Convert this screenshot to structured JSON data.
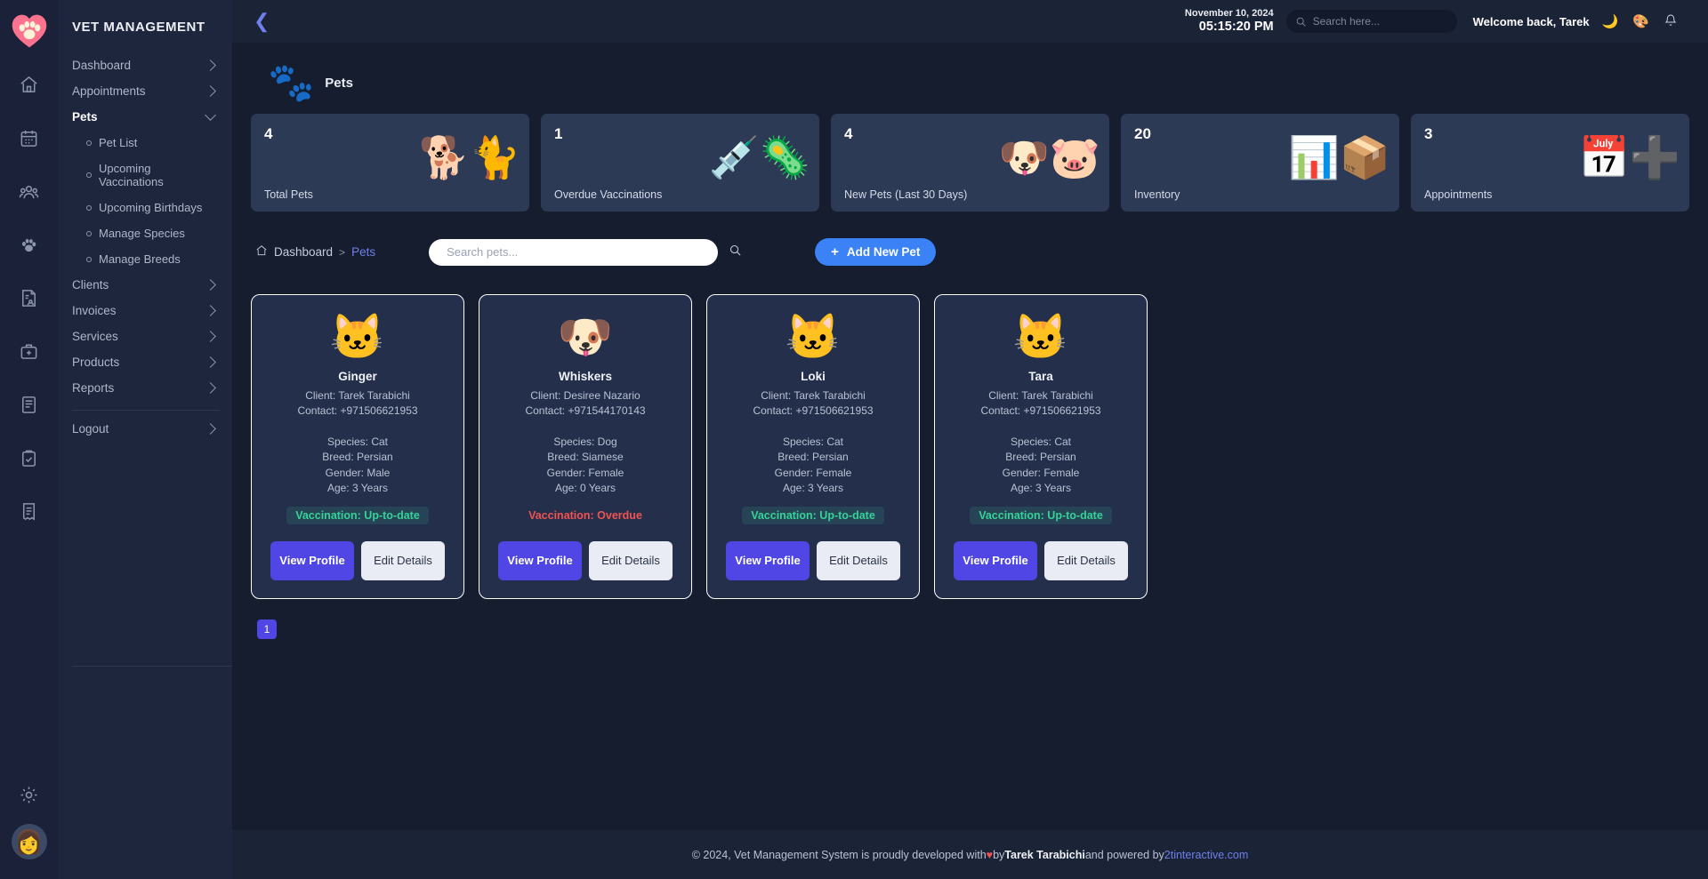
{
  "brand": {
    "logo_icon": "paw-heart-logo",
    "title": "VET MANAGEMENT"
  },
  "rail": {
    "items": [
      {
        "name": "home-icon"
      },
      {
        "name": "calendar-icon"
      },
      {
        "name": "clients-icon"
      },
      {
        "name": "paw-icon"
      },
      {
        "name": "records-icon"
      },
      {
        "name": "medkit-icon"
      },
      {
        "name": "document-icon"
      },
      {
        "name": "clipboard-check-icon"
      },
      {
        "name": "invoice-icon"
      }
    ],
    "settings_icon": "gear-icon",
    "avatar_icon": "user-avatar"
  },
  "sidebar": {
    "items": [
      {
        "label": "Dashboard",
        "expanded": false,
        "active": false
      },
      {
        "label": "Appointments",
        "expanded": false,
        "active": false
      },
      {
        "label": "Pets",
        "expanded": true,
        "active": true
      },
      {
        "label": "Clients",
        "expanded": false,
        "active": false
      },
      {
        "label": "Invoices",
        "expanded": false,
        "active": false
      },
      {
        "label": "Services",
        "expanded": false,
        "active": false
      },
      {
        "label": "Products",
        "expanded": false,
        "active": false
      },
      {
        "label": "Reports",
        "expanded": false,
        "active": false
      }
    ],
    "pets_submenu": [
      {
        "label": "Pet List"
      },
      {
        "label": "Upcoming Vaccinations"
      },
      {
        "label": "Upcoming Birthdays"
      },
      {
        "label": "Manage Species"
      },
      {
        "label": "Manage Breeds"
      }
    ],
    "logout": {
      "label": "Logout"
    }
  },
  "topbar": {
    "back_icon": "chevron-left-icon",
    "date": "November 10, 2024",
    "time": "05:15:20 PM",
    "search": {
      "placeholder": "Search here...",
      "value": "",
      "icon": "search-icon"
    },
    "welcome": "Welcome back, Tarek",
    "theme_toggle_icon": "moon-icon",
    "palette_icon": "palette-icon",
    "notifications_icon": "bell-icon"
  },
  "page": {
    "icon": "pets-box-icon",
    "title": "Pets"
  },
  "stats": [
    {
      "value": "4",
      "label": "Total Pets",
      "icon": "dog-cat-icon"
    },
    {
      "value": "1",
      "label": "Overdue Vaccinations",
      "icon": "syringe-virus-icon"
    },
    {
      "value": "4",
      "label": "New Pets (Last 30 Days)",
      "icon": "two-pets-icon"
    },
    {
      "value": "20",
      "label": "Inventory",
      "icon": "inventory-chart-icon"
    },
    {
      "value": "3",
      "label": "Appointments",
      "icon": "calendar-plus-icon"
    }
  ],
  "breadcrumb": {
    "home_icon": "home-icon",
    "root": "Dashboard",
    "separator": ">",
    "current": "Pets"
  },
  "pet_search": {
    "placeholder": "Search pets...",
    "value": "",
    "button_icon": "search-icon"
  },
  "add_pet_button": {
    "plus": "+",
    "label": "Add New Pet"
  },
  "labels": {
    "client_prefix": "Client: ",
    "contact_prefix": "Contact: ",
    "species_prefix": "Species: ",
    "breed_prefix": "Breed: ",
    "gender_prefix": "Gender: ",
    "age_prefix": "Age: ",
    "view_profile": "View Profile",
    "edit_details": "Edit Details"
  },
  "pets": [
    {
      "avatar_icon": "cat-face-icon",
      "name": "Ginger",
      "client": "Client: Tarek Tarabichi",
      "contact": "Contact: +971506621953",
      "species": "Species: Cat",
      "breed": "Breed: Persian",
      "gender": "Gender: Male",
      "age": "Age: 3 Years",
      "vaccination": "Vaccination: Up-to-date",
      "vaccination_status": "ok",
      "view_label": "View Profile",
      "edit_label": "Edit Details"
    },
    {
      "avatar_icon": "dog-face-icon",
      "name": "Whiskers",
      "client": "Client: Desiree Nazario",
      "contact": "Contact: +971544170143",
      "species": "Species: Dog",
      "breed": "Breed: Siamese",
      "gender": "Gender: Female",
      "age": "Age: 0 Years",
      "vaccination": "Vaccination: Overdue",
      "vaccination_status": "overdue",
      "view_label": "View Profile",
      "edit_label": "Edit Details"
    },
    {
      "avatar_icon": "cat-face-icon",
      "name": "Loki",
      "client": "Client: Tarek Tarabichi",
      "contact": "Contact: +971506621953",
      "species": "Species: Cat",
      "breed": "Breed: Persian",
      "gender": "Gender: Female",
      "age": "Age: 3 Years",
      "vaccination": "Vaccination: Up-to-date",
      "vaccination_status": "ok",
      "view_label": "View Profile",
      "edit_label": "Edit Details"
    },
    {
      "avatar_icon": "cat-face-icon",
      "name": "Tara",
      "client": "Client: Tarek Tarabichi",
      "contact": "Contact: +971506621953",
      "species": "Species: Cat",
      "breed": "Breed: Persian",
      "gender": "Gender: Female",
      "age": "Age: 3 Years",
      "vaccination": "Vaccination: Up-to-date",
      "vaccination_status": "ok",
      "view_label": "View Profile",
      "edit_label": "Edit Details"
    }
  ],
  "pagination": {
    "pages": [
      "1"
    ],
    "current": "1"
  },
  "footer": {
    "prefix": "© 2024, Vet Management System is proudly developed with ",
    "heart": "♥",
    "by": " by ",
    "author": "Tarek Tarabichi",
    "middle": " and powered by ",
    "company": "2tinteractive.com"
  },
  "colors": {
    "accent_blue": "#3b82f6",
    "accent_indigo": "#4f46e5",
    "link": "#6f7fec",
    "success": "#34d399",
    "danger": "#f05252",
    "sidebar_bg": "#1e263e",
    "card_bg": "#24304b",
    "stat_bg": "#2d3a55",
    "page_bg": "#161d2f"
  }
}
